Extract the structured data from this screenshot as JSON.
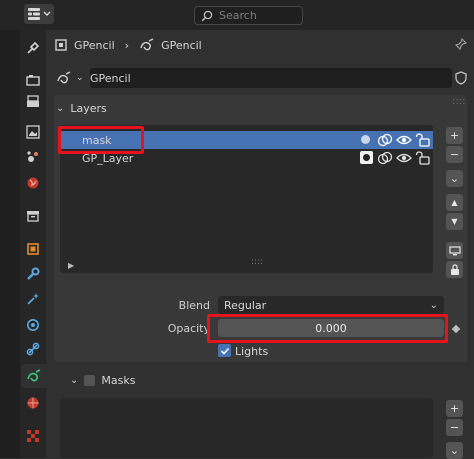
{
  "header": {
    "search_placeholder": "Search"
  },
  "breadcrumb": {
    "object_name": "GPencil",
    "data_name": "GPencil"
  },
  "datablock": {
    "name": "GPencil"
  },
  "layers": {
    "title": "Layers",
    "items": [
      {
        "name": "mask",
        "selected": true
      },
      {
        "name": "GP_Layer",
        "selected": false
      }
    ]
  },
  "props": {
    "blend_label": "Blend",
    "blend_value": "Regular",
    "opacity_label": "Opacity",
    "opacity_value": "0.000",
    "lights_label": "Lights",
    "lights_checked": true
  },
  "masks": {
    "title": "Masks",
    "enabled": false
  },
  "colors": {
    "accent": "#4772b3",
    "highlight_box": "#e3141c",
    "panel": "#383838",
    "background": "#303030"
  }
}
